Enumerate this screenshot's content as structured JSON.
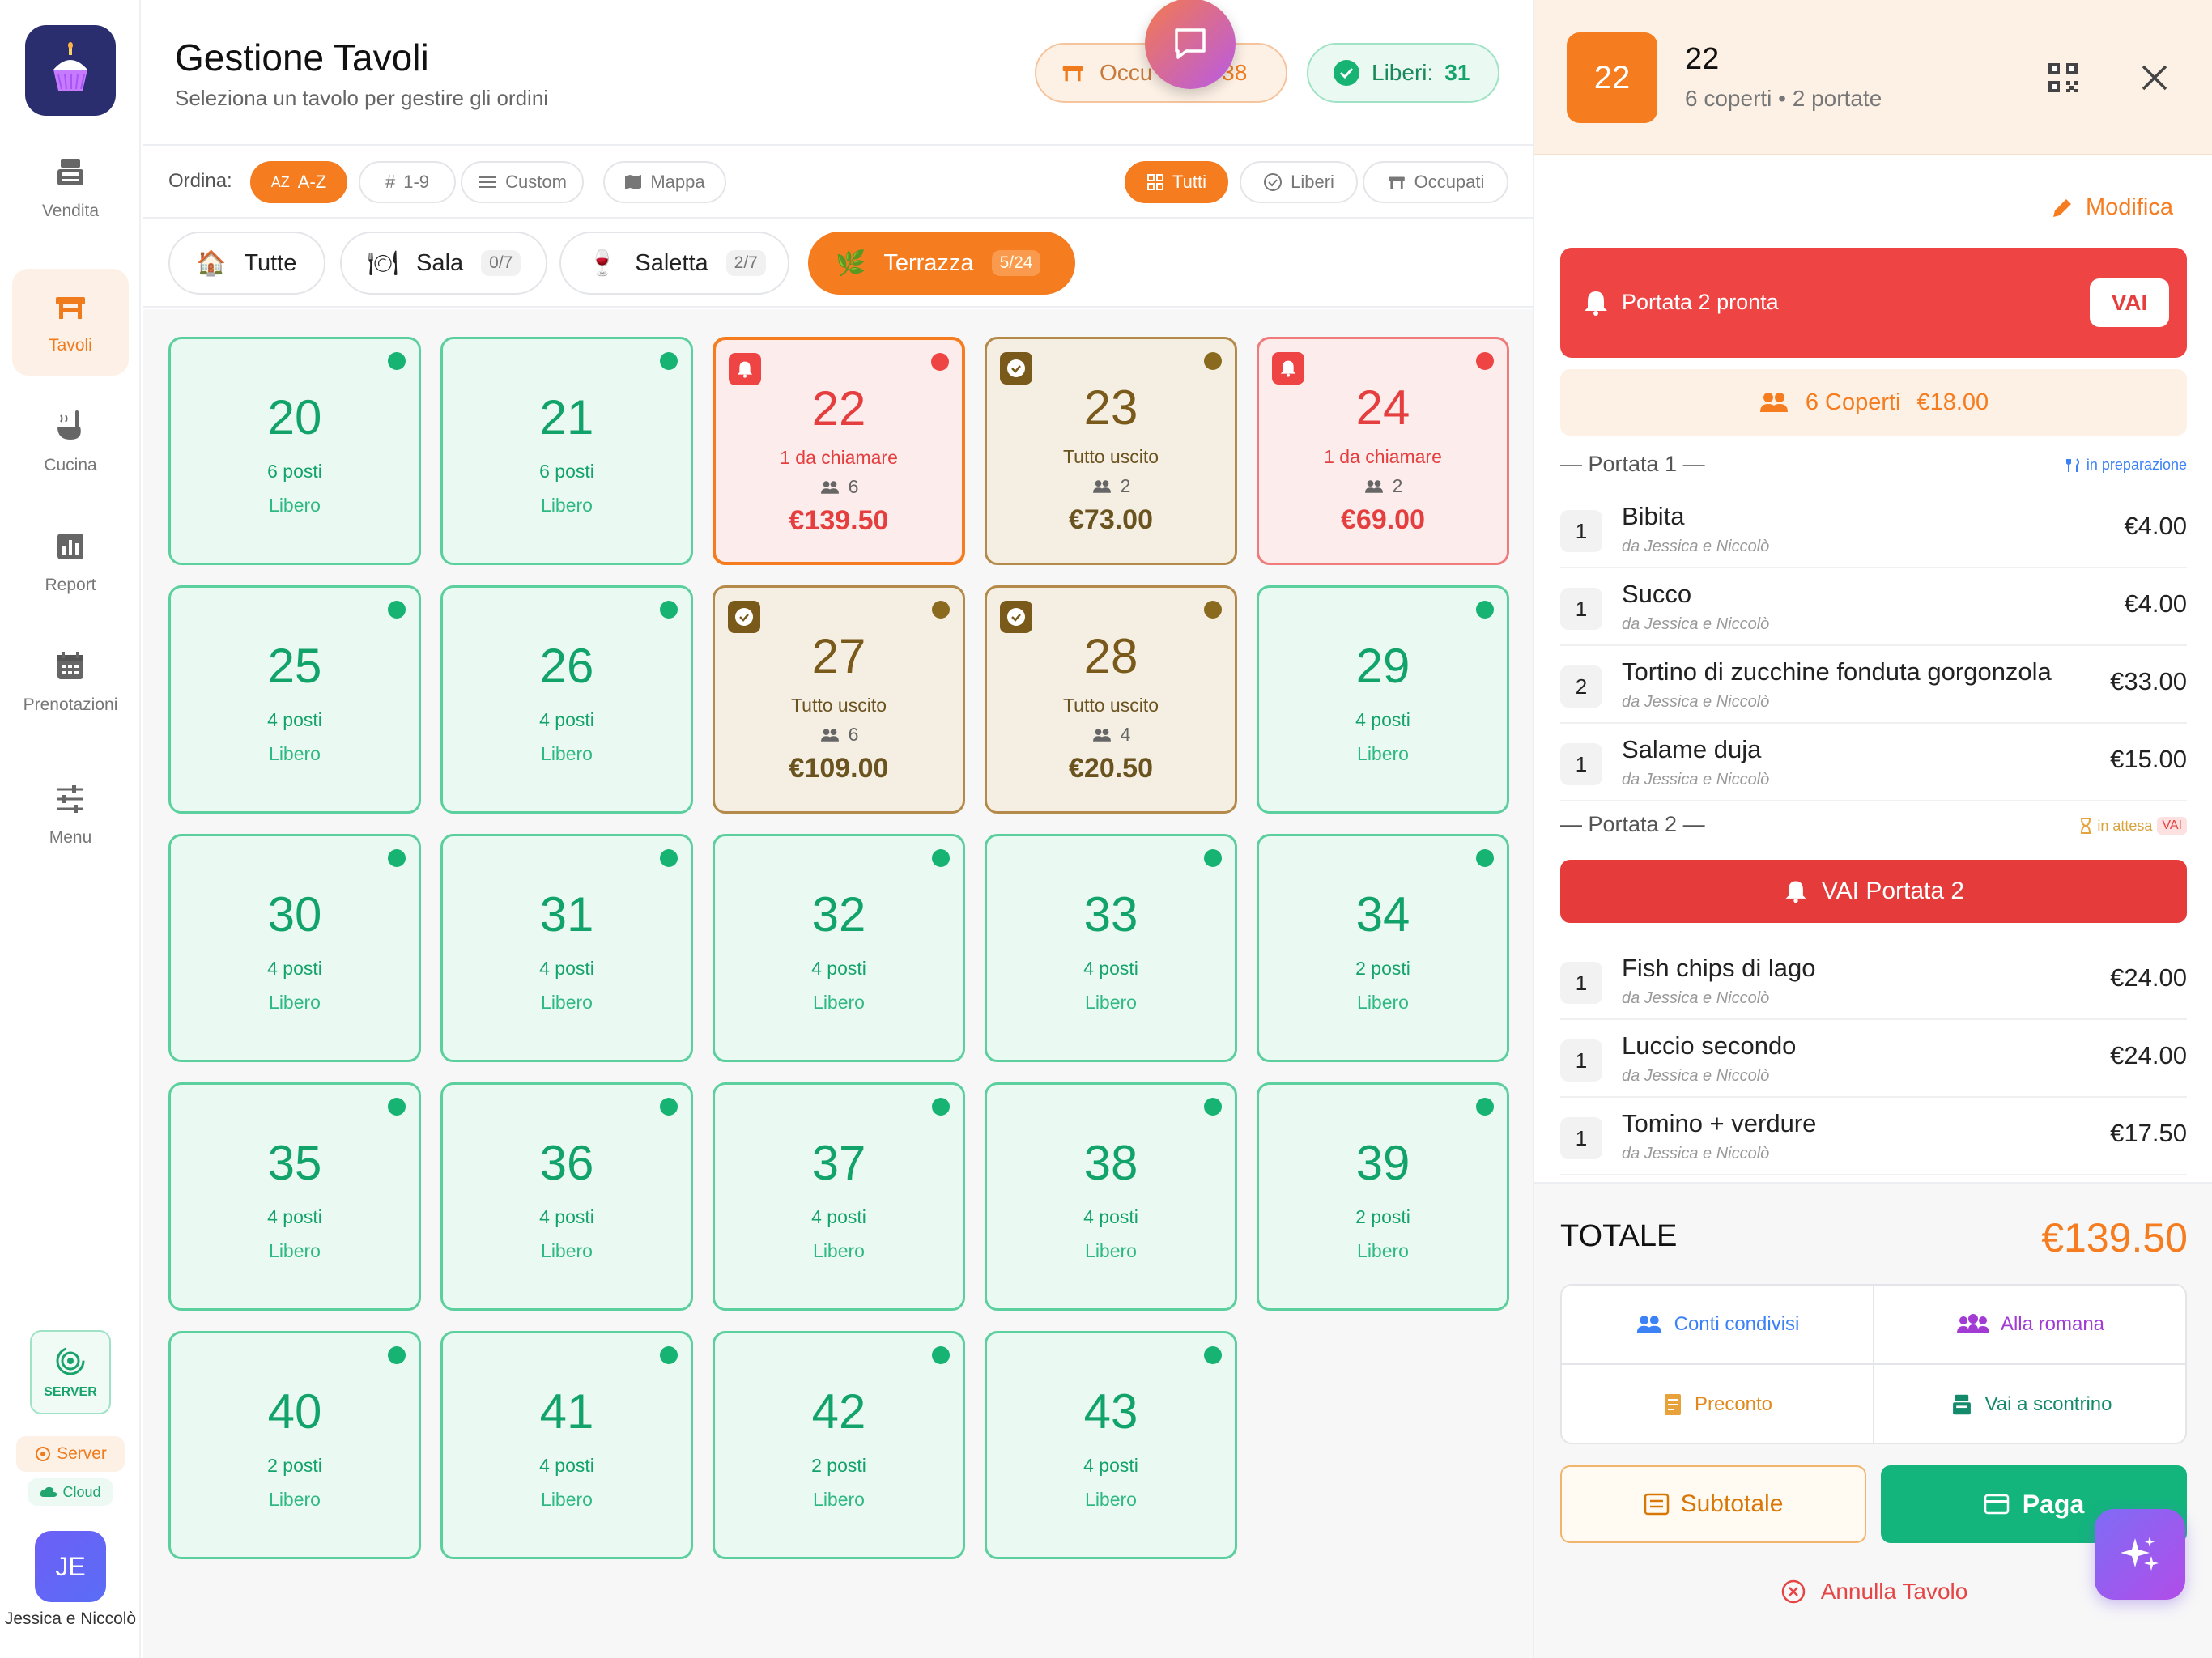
{
  "sidebar": {
    "items": [
      {
        "label": "Vendita",
        "icon": "register-icon",
        "active": false
      },
      {
        "label": "Tavoli",
        "icon": "table-icon",
        "active": true
      },
      {
        "label": "Cucina",
        "icon": "ladle-icon",
        "active": false
      },
      {
        "label": "Report",
        "icon": "chart-icon",
        "active": false
      },
      {
        "label": "Prenotazioni",
        "icon": "calendar-icon",
        "active": false
      },
      {
        "label": "Menu",
        "icon": "sliders-icon",
        "active": false
      }
    ],
    "server_box": "SERVER",
    "server_pill": "Server",
    "cloud_pill": "Cloud",
    "avatar_initials": "JE",
    "user_name": "Jessica e Niccolò"
  },
  "header": {
    "title": "Gestione Tavoli",
    "subtitle": "Seleziona un tavolo per gestire gli ordini",
    "occupied_label": "Occupati:",
    "occupied_value": "38",
    "occupied_visible": "Occu",
    "occupied_visible_tail": "/38",
    "free_label": "Liberi:",
    "free_value": "31"
  },
  "toolbar": {
    "sort_label": "Ordina:",
    "sort_options": [
      "A-Z",
      "1-9",
      "Custom",
      "Mappa"
    ],
    "filters": [
      "Tutti",
      "Liberi",
      "Occupati"
    ]
  },
  "categories": [
    {
      "label": "Tutte",
      "count": ""
    },
    {
      "label": "Sala",
      "count": "0/7"
    },
    {
      "label": "Saletta",
      "count": "2/7"
    },
    {
      "label": "Terrazza",
      "count": "5/24"
    }
  ],
  "tables": [
    {
      "num": "20",
      "state": "free",
      "seats": "6 posti",
      "status": "Libero"
    },
    {
      "num": "21",
      "state": "free",
      "seats": "6 posti",
      "status": "Libero"
    },
    {
      "num": "22",
      "state": "alert",
      "line1": "1 da chiamare",
      "people": "6",
      "amount": "€139.50",
      "selected": true
    },
    {
      "num": "23",
      "state": "busy",
      "line1": "Tutto uscito",
      "people": "2",
      "amount": "€73.00"
    },
    {
      "num": "24",
      "state": "alert",
      "line1": "1 da chiamare",
      "people": "2",
      "amount": "€69.00"
    },
    {
      "num": "25",
      "state": "free",
      "seats": "4 posti",
      "status": "Libero"
    },
    {
      "num": "26",
      "state": "free",
      "seats": "4 posti",
      "status": "Libero"
    },
    {
      "num": "27",
      "state": "busy",
      "line1": "Tutto uscito",
      "people": "6",
      "amount": "€109.00"
    },
    {
      "num": "28",
      "state": "busy",
      "line1": "Tutto uscito",
      "people": "4",
      "amount": "€20.50"
    },
    {
      "num": "29",
      "state": "free",
      "seats": "4 posti",
      "status": "Libero"
    },
    {
      "num": "30",
      "state": "free",
      "seats": "4 posti",
      "status": "Libero"
    },
    {
      "num": "31",
      "state": "free",
      "seats": "4 posti",
      "status": "Libero"
    },
    {
      "num": "32",
      "state": "free",
      "seats": "4 posti",
      "status": "Libero"
    },
    {
      "num": "33",
      "state": "free",
      "seats": "4 posti",
      "status": "Libero"
    },
    {
      "num": "34",
      "state": "free",
      "seats": "2 posti",
      "status": "Libero"
    },
    {
      "num": "35",
      "state": "free",
      "seats": "4 posti",
      "status": "Libero"
    },
    {
      "num": "36",
      "state": "free",
      "seats": "4 posti",
      "status": "Libero"
    },
    {
      "num": "37",
      "state": "free",
      "seats": "4 posti",
      "status": "Libero"
    },
    {
      "num": "38",
      "state": "free",
      "seats": "4 posti",
      "status": "Libero"
    },
    {
      "num": "39",
      "state": "free",
      "seats": "2 posti",
      "status": "Libero"
    },
    {
      "num": "40",
      "state": "free",
      "seats": "2 posti",
      "status": "Libero"
    },
    {
      "num": "41",
      "state": "free",
      "seats": "4 posti",
      "status": "Libero"
    },
    {
      "num": "42",
      "state": "free",
      "seats": "2 posti",
      "status": "Libero"
    },
    {
      "num": "43",
      "state": "free",
      "seats": "4 posti",
      "status": "Libero"
    }
  ],
  "panel": {
    "table_num": "22",
    "title": "22",
    "subtitle": "6 coperti • 2 portate",
    "edit_label": "Modifica",
    "alert_text": "Portata 2 pronta",
    "alert_button": "VAI",
    "coperti_label": "6 Coperti",
    "coperti_price": "€18.00",
    "course1": {
      "label": "— Portata 1 —",
      "status": "in preparazione"
    },
    "course1_items": [
      {
        "qty": "1",
        "name": "Bibita",
        "by": "da Jessica e Niccolò",
        "price": "€4.00"
      },
      {
        "qty": "1",
        "name": "Succo",
        "by": "da Jessica e Niccolò",
        "price": "€4.00"
      },
      {
        "qty": "2",
        "name": "Tortino di zucchine fonduta gorgonzola",
        "by": "da Jessica e Niccolò",
        "price": "€33.00"
      },
      {
        "qty": "1",
        "name": "Salame duja",
        "by": "da Jessica e Niccolò",
        "price": "€15.00"
      }
    ],
    "course2": {
      "label": "— Portata 2 —",
      "status": "in attesa",
      "tag": "VAI"
    },
    "vai_button": "VAI Portata 2",
    "course2_items": [
      {
        "qty": "1",
        "name": "Fish chips di lago",
        "by": "da Jessica e Niccolò",
        "price": "€24.00"
      },
      {
        "qty": "1",
        "name": "Luccio secondo",
        "by": "da Jessica e Niccolò",
        "price": "€24.00"
      },
      {
        "qty": "1",
        "name": "Tomino + verdure",
        "by": "da Jessica e Niccolò",
        "price": "€17.50"
      }
    ],
    "total_label": "TOTALE",
    "total_value": "€139.50",
    "options": [
      "Conti condivisi",
      "Alla romana",
      "Preconto",
      "Vai a scontrino"
    ],
    "subtotal_button": "Subtotale",
    "pay_button": "Paga",
    "cancel_label": "Annulla Tavolo"
  },
  "colors": {
    "accent": "#f57c1f",
    "free": "#12a36b",
    "alert": "#ef4444",
    "busy": "#7a5a1b",
    "pay": "#13b57d"
  }
}
